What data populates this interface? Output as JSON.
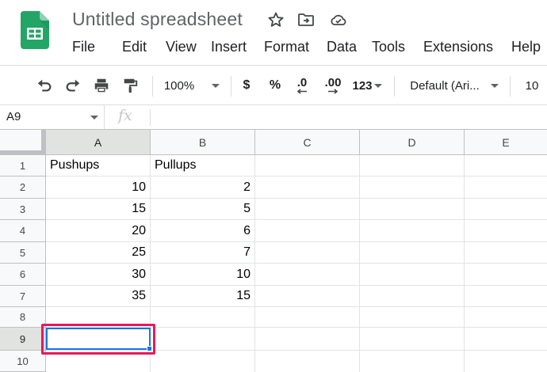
{
  "doc": {
    "title": "Untitled spreadsheet"
  },
  "menu": [
    "File",
    "Edit",
    "View",
    "Insert",
    "Format",
    "Data",
    "Tools",
    "Extensions",
    "Help"
  ],
  "toolbar": {
    "zoom": "100%",
    "currency": "$",
    "percent": "%",
    "decrease_decimal": ".0",
    "increase_decimal": ".00",
    "number_format": "123",
    "font": "Default (Ari...",
    "font_size": "10"
  },
  "formula_bar": {
    "name_box": "A9",
    "fx": "fx"
  },
  "grid": {
    "columns": [
      "A",
      "B",
      "C",
      "D",
      "E"
    ],
    "rows": [
      "1",
      "2",
      "3",
      "4",
      "5",
      "6",
      "7",
      "8",
      "9",
      "10"
    ],
    "cells": [
      [
        "Pushups",
        "Pullups"
      ],
      [
        "10",
        "2"
      ],
      [
        "15",
        "5"
      ],
      [
        "20",
        "6"
      ],
      [
        "25",
        "7"
      ],
      [
        "30",
        "10"
      ],
      [
        "35",
        "15"
      ]
    ],
    "active_cell": "A9"
  },
  "colors": {
    "brand_green": "#23a566",
    "selection_blue": "#1a73e8",
    "highlight_pink": "#e8185a"
  }
}
